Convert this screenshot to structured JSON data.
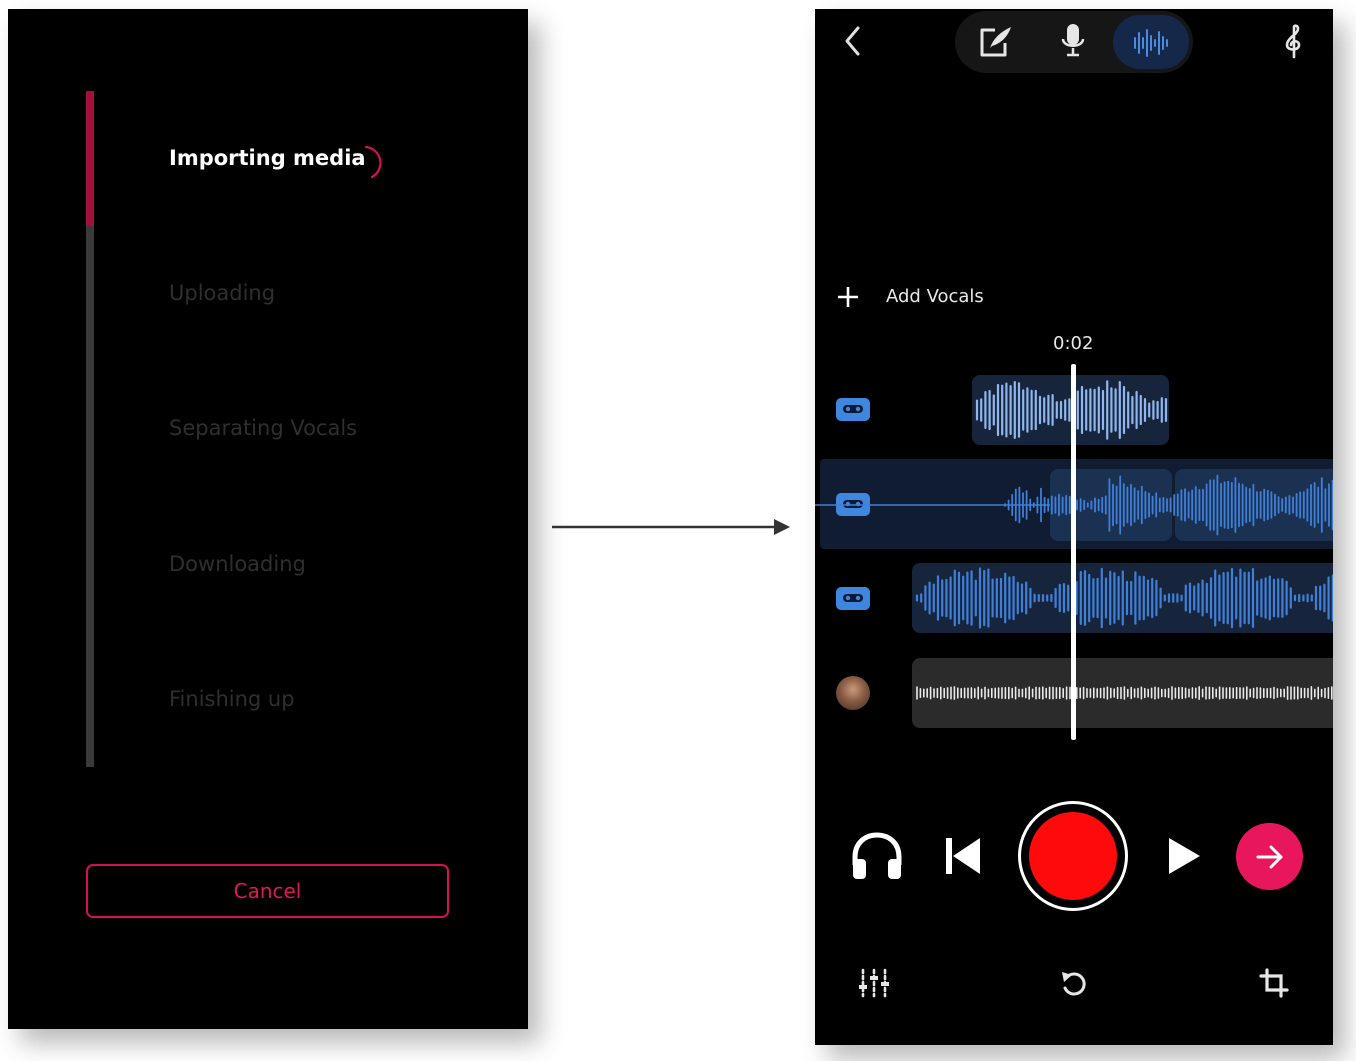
{
  "import_screen": {
    "steps": [
      {
        "label": "Importing media",
        "state": "active"
      },
      {
        "label": "Uploading",
        "state": "pending"
      },
      {
        "label": "Separating Vocals",
        "state": "pending"
      },
      {
        "label": "Downloading",
        "state": "pending"
      },
      {
        "label": "Finishing up",
        "state": "pending"
      }
    ],
    "progress_fraction": 0.2,
    "cancel_label": "Cancel",
    "accent_color": "#d3124f"
  },
  "editor_screen": {
    "toolbar": {
      "back_icon": "chevron-left-icon",
      "modes": [
        {
          "icon": "edit-lyrics-icon",
          "selected": false
        },
        {
          "icon": "microphone-icon",
          "selected": false
        },
        {
          "icon": "waveform-icon",
          "selected": true
        }
      ],
      "right_icon": "treble-clef-icon"
    },
    "add_vocals_label": "Add Vocals",
    "current_time": "0:02",
    "tracks": [
      {
        "type": "vocal",
        "icon": "cassette-icon"
      },
      {
        "type": "vocal",
        "icon": "cassette-icon",
        "selected": true
      },
      {
        "type": "vocal",
        "icon": "cassette-icon"
      },
      {
        "type": "backing",
        "icon": "avatar"
      }
    ],
    "transport": [
      {
        "icon": "headphones-icon"
      },
      {
        "icon": "skip-back-icon"
      },
      {
        "icon": "record-icon"
      },
      {
        "icon": "play-icon"
      },
      {
        "icon": "arrow-right-icon"
      }
    ],
    "bottom_toolbar": [
      {
        "icon": "mixer-sliders-icon"
      },
      {
        "icon": "undo-icon"
      },
      {
        "icon": "crop-icon"
      }
    ],
    "colors": {
      "waveform": "#4a8be0",
      "record": "#ff0a0a",
      "next": "#e8175d",
      "clip_dark": "#17253c"
    }
  }
}
